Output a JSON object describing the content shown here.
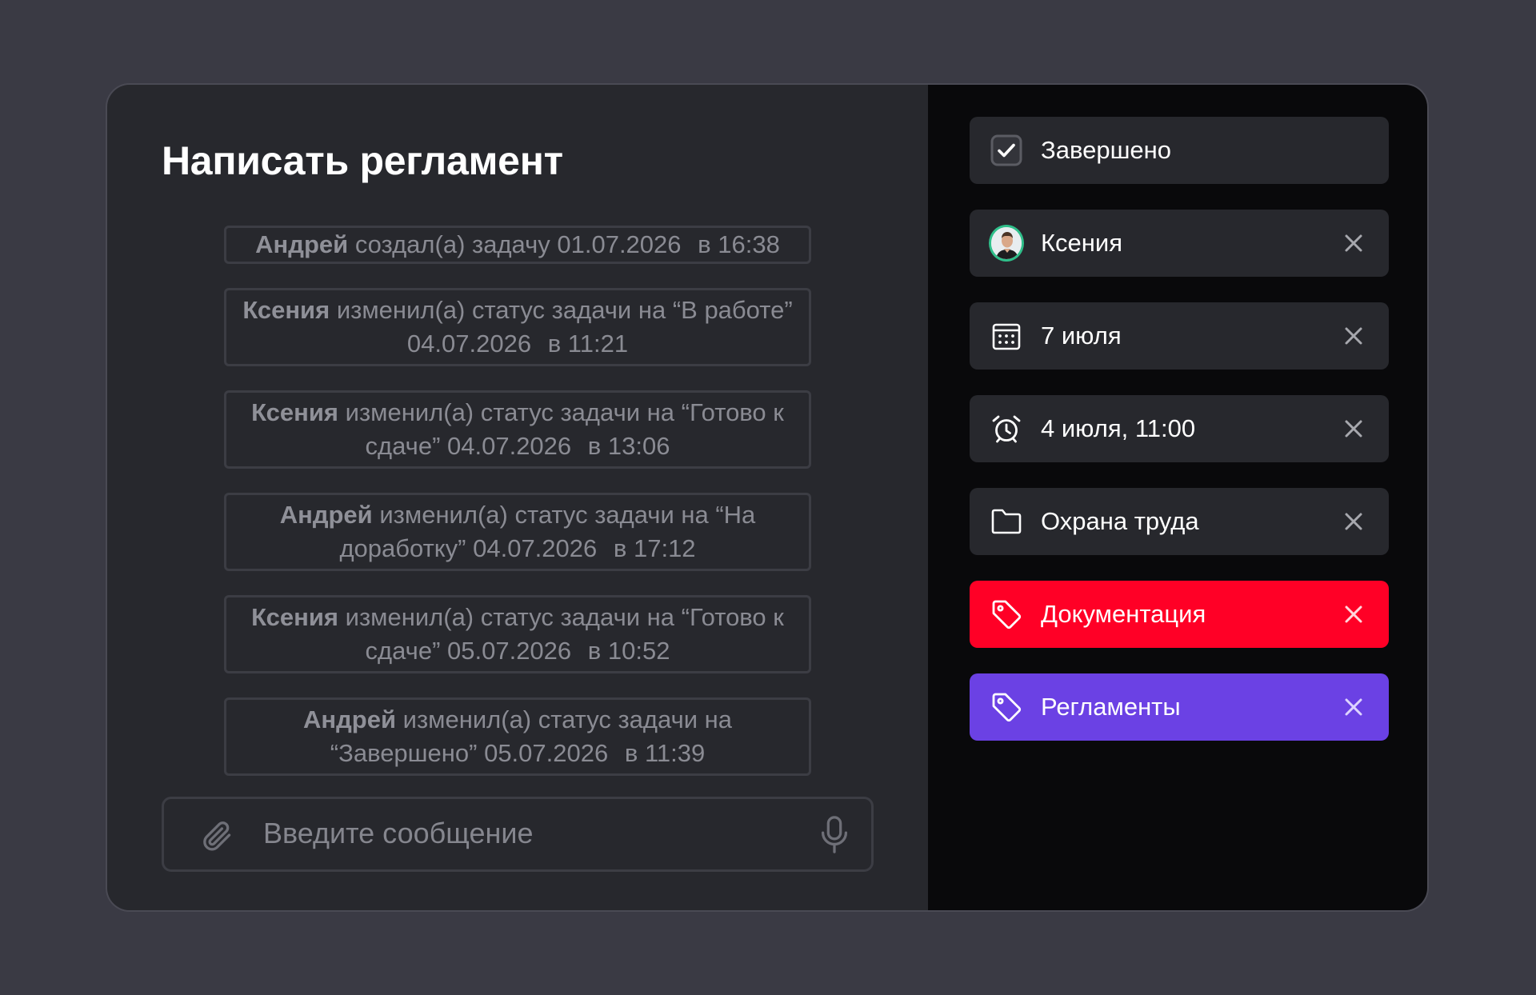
{
  "task": {
    "title": "Написать регламент"
  },
  "history": [
    {
      "author": "Андрей",
      "text": "создал(а) задачу 01.07.2026",
      "time": "в 16:38"
    },
    {
      "author": "Ксения",
      "line1": "изменил(а) статус задачи на “В работе”",
      "line2": "04.07.2026",
      "time": "в 11:21"
    },
    {
      "author": "Ксения",
      "line1": "изменил(а) статус задачи на “Готово к",
      "line2": "сдаче” 04.07.2026",
      "time": "в 13:06"
    },
    {
      "author": "Андрей",
      "line1": "изменил(а) статус задачи на “На",
      "line2": "доработку” 04.07.2026",
      "time": "в 17:12"
    },
    {
      "author": "Ксения",
      "line1": "изменил(а) статус задачи на “Готово к",
      "line2": "сдаче” 05.07.2026",
      "time": "в 10:52"
    },
    {
      "author": "Андрей",
      "line1": "изменил(а) статус задачи на",
      "line2": "“Завершено” 05.07.2026",
      "time": "в 11:39"
    }
  ],
  "composer": {
    "placeholder": "Введите сообщение",
    "attach_icon": "paperclip-icon",
    "mic_icon": "microphone-icon"
  },
  "properties": {
    "status": {
      "label": "Завершено",
      "icon": "checkbox-checked-icon"
    },
    "assignee": {
      "label": "Ксения",
      "icon": "avatar"
    },
    "due_date": {
      "label": "7 июля",
      "icon": "calendar-icon"
    },
    "reminder": {
      "label": "4 июля, 11:00",
      "icon": "alarm-clock-icon"
    },
    "project": {
      "label": "Охрана труда",
      "icon": "folder-icon"
    },
    "tags": [
      {
        "label": "Документация",
        "icon": "tag-icon",
        "color": "#ff0026"
      },
      {
        "label": "Регламенты",
        "icon": "tag-icon",
        "color": "#6b41e4"
      }
    ]
  },
  "colors": {
    "background": "#3a3a44",
    "left_panel": "#27282d",
    "right_panel": "#09090b",
    "accent_green": "#2fbf8a"
  }
}
